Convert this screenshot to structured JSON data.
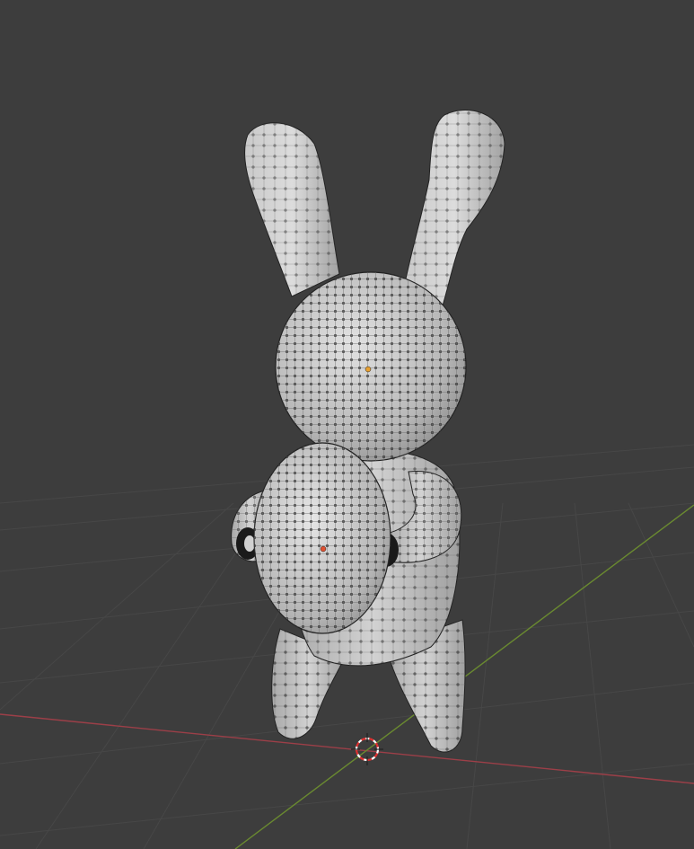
{
  "viewport": {
    "mode": "edit-mode",
    "shading": "solid",
    "background_color": "#3d3d3d",
    "grid_color": "#4a4a4a",
    "x_axis_color": "#9c3f48",
    "y_axis_color": "#6a8a30",
    "mesh_color": "#c4c4c4",
    "vertex_color": "#111111",
    "origin_color": "#e8a030",
    "selected_origin_color": "#e05030",
    "cursor_ring_colors": [
      "#ffffff",
      "#e03030"
    ]
  },
  "scene": {
    "object": "rabbit-mesh",
    "parts": [
      "left-ear",
      "right-ear",
      "head",
      "body",
      "left-arm",
      "right-arm",
      "egg",
      "left-leg",
      "right-leg"
    ]
  }
}
